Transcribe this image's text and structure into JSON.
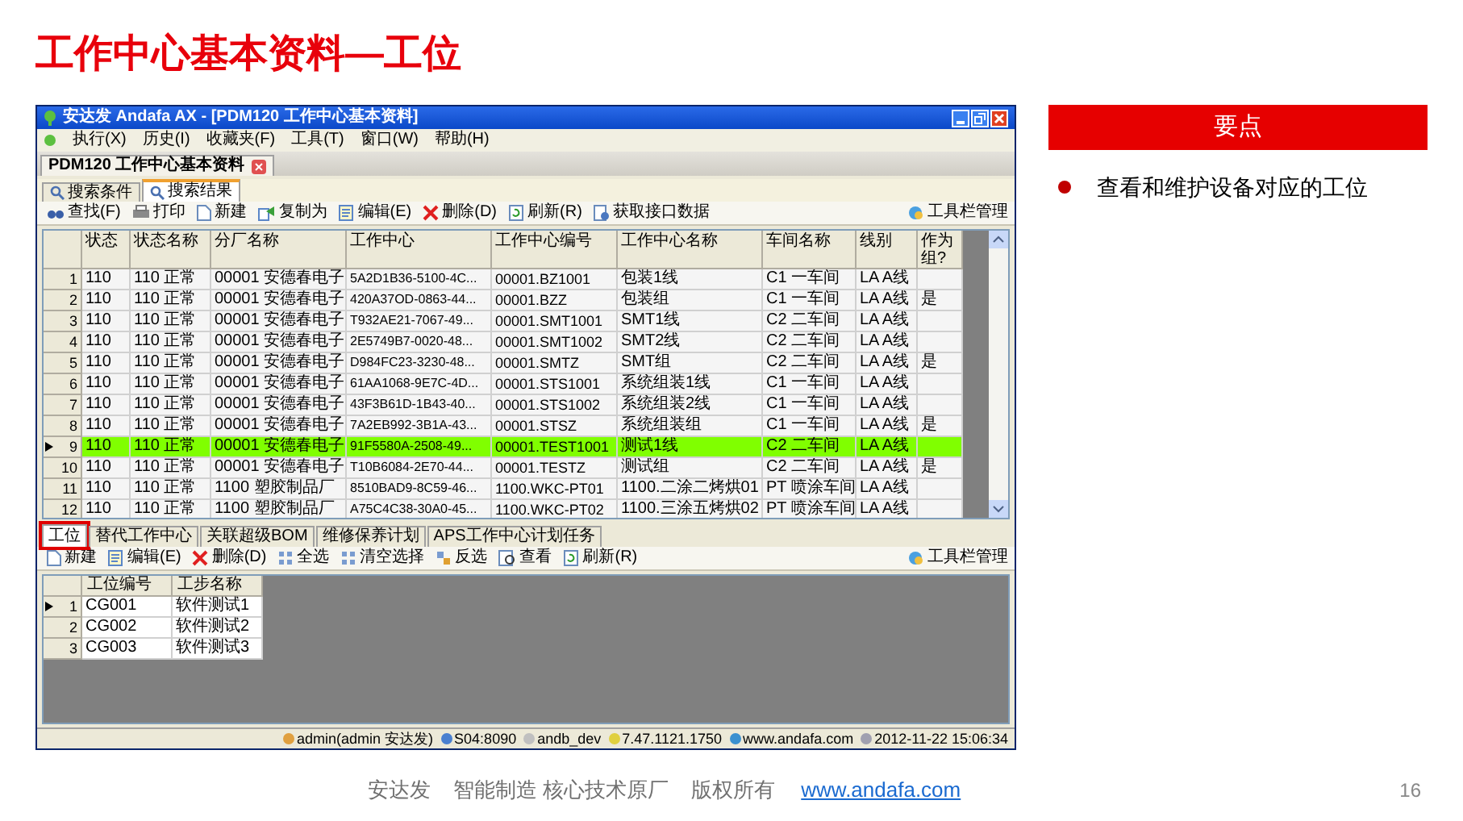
{
  "slide": {
    "title": "工作中心基本资料—工位",
    "keypoints": {
      "heading": "要点",
      "items": [
        "查看和维护设备对应的工位"
      ]
    },
    "footer": {
      "texts": [
        "安达发",
        "智能制造 核心技术原厂",
        "版权所有"
      ],
      "link": "www.andafa.com",
      "page": "16"
    }
  },
  "window": {
    "title": "安达发 Andafa AX - [PDM120 工作中心基本资料]",
    "menu": [
      "执行(X)",
      "历史(I)",
      "收藏夹(F)",
      "工具(T)",
      "窗口(W)",
      "帮助(H)"
    ],
    "doc_tab": "PDM120 工作中心基本资料",
    "search_tabs": [
      {
        "label": "搜索条件",
        "selected": false
      },
      {
        "label": "搜索结果",
        "selected": true
      }
    ],
    "toolbar": [
      "查找(F)",
      "打印",
      "新建",
      "复制为",
      "编辑(E)",
      "删除(D)",
      "刷新(R)",
      "获取接口数据"
    ],
    "toolbar_right": "工具栏管理",
    "table": {
      "columns": [
        "状态",
        "状态名称",
        "分厂名称",
        "工作中心",
        "工作中心编号",
        "工作中心名称",
        "车间名称",
        "线别",
        "作为组?"
      ],
      "rows": [
        {
          "num": "1",
          "selected": false,
          "cells": [
            "110",
            "110 正常",
            "00001 安德春电子",
            "5A2D1B36-5100-4C...",
            "00001.BZ1001",
            "包装1线",
            "C1 一车间",
            "LA A线",
            ""
          ]
        },
        {
          "num": "2",
          "selected": false,
          "cells": [
            "110",
            "110 正常",
            "00001 安德春电子",
            "420A37OD-0863-44...",
            "00001.BZZ",
            "包装组",
            "C1 一车间",
            "LA A线",
            "是"
          ]
        },
        {
          "num": "3",
          "selected": false,
          "cells": [
            "110",
            "110 正常",
            "00001 安德春电子",
            "T932AE21-7067-49...",
            "00001.SMT1001",
            "SMT1线",
            "C2 二车间",
            "LA A线",
            ""
          ]
        },
        {
          "num": "4",
          "selected": false,
          "cells": [
            "110",
            "110 正常",
            "00001 安德春电子",
            "2E5749B7-0020-48...",
            "00001.SMT1002",
            "SMT2线",
            "C2 二车间",
            "LA A线",
            ""
          ]
        },
        {
          "num": "5",
          "selected": false,
          "cells": [
            "110",
            "110 正常",
            "00001 安德春电子",
            "D984FC23-3230-48...",
            "00001.SMTZ",
            "SMT组",
            "C2 二车间",
            "LA A线",
            "是"
          ]
        },
        {
          "num": "6",
          "selected": false,
          "cells": [
            "110",
            "110 正常",
            "00001 安德春电子",
            "61AA1068-9E7C-4D...",
            "00001.STS1001",
            "系统组装1线",
            "C1 一车间",
            "LA A线",
            ""
          ]
        },
        {
          "num": "7",
          "selected": false,
          "cells": [
            "110",
            "110 正常",
            "00001 安德春电子",
            "43F3B61D-1B43-40...",
            "00001.STS1002",
            "系统组装2线",
            "C1 一车间",
            "LA A线",
            ""
          ]
        },
        {
          "num": "8",
          "selected": false,
          "cells": [
            "110",
            "110 正常",
            "00001 安德春电子",
            "7A2EB992-3B1A-43...",
            "00001.STSZ",
            "系统组装组",
            "C1 一车间",
            "LA A线",
            "是"
          ]
        },
        {
          "num": "9",
          "selected": true,
          "cells": [
            "110",
            "110 正常",
            "00001 安德春电子",
            "91F5580A-2508-49...",
            "00001.TEST1001",
            "测试1线",
            "C2 二车间",
            "LA A线",
            ""
          ]
        },
        {
          "num": "10",
          "selected": false,
          "cells": [
            "110",
            "110 正常",
            "00001 安德春电子",
            "T10B6084-2E70-44...",
            "00001.TESTZ",
            "测试组",
            "C2 二车间",
            "LA A线",
            "是"
          ]
        },
        {
          "num": "11",
          "selected": false,
          "cells": [
            "110",
            "110 正常",
            "1100 塑胶制品厂",
            "8510BAD9-8C59-46...",
            "1100.WKC-PT01",
            "1100.二涂二烤烘01",
            "PT 喷涂车间",
            "LA A线",
            ""
          ]
        },
        {
          "num": "12",
          "selected": false,
          "cells": [
            "110",
            "110 正常",
            "1100 塑胶制品厂",
            "A75C4C38-30A0-45...",
            "1100.WKC-PT02",
            "1100.三涂五烤烘02",
            "PT 喷涂车间",
            "LA A线",
            ""
          ]
        }
      ]
    },
    "detail_tabs": [
      {
        "label": "工位",
        "selected": true,
        "highlighted": true
      },
      {
        "label": "替代工作中心",
        "selected": false,
        "highlighted": false
      },
      {
        "label": "关联超级BOM",
        "selected": false,
        "highlighted": false
      },
      {
        "label": "维修保养计划",
        "selected": false,
        "highlighted": false
      },
      {
        "label": "APS工作中心计划任务",
        "selected": false,
        "highlighted": false
      }
    ],
    "detail_toolbar": [
      "新建",
      "编辑(E)",
      "删除(D)",
      "全选",
      "清空选择",
      "反选",
      "查看",
      "刷新(R)"
    ],
    "detail_toolbar_right": "工具栏管理",
    "detail_table": {
      "columns": [
        "工位编号",
        "工步名称"
      ],
      "rows": [
        {
          "num": "1",
          "selected": true,
          "cells": [
            "CG001",
            "软件测试1"
          ]
        },
        {
          "num": "2",
          "selected": false,
          "cells": [
            "CG002",
            "软件测试2"
          ]
        },
        {
          "num": "3",
          "selected": false,
          "cells": [
            "CG003",
            "软件测试3"
          ]
        }
      ]
    },
    "status_bar": [
      "admin(admin 安达发)",
      "S04:8090",
      "andb_dev",
      "7.47.1121.1750",
      "www.andafa.com",
      "2012-11-22 15:06:34"
    ]
  }
}
